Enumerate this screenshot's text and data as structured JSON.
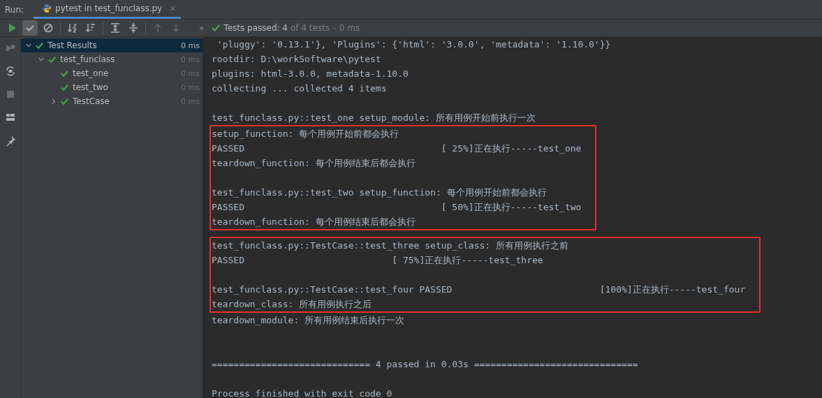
{
  "run_bar": {
    "label": "Run:",
    "tabs": [
      {
        "title": "pytest in test_funclass.py",
        "selected": true
      }
    ]
  },
  "toolbar": {
    "buttons": [
      {
        "kind": "run",
        "selected": false,
        "disabled": false
      },
      {
        "kind": "passed",
        "selected": true,
        "disabled": false
      },
      {
        "kind": "ignored",
        "selected": false,
        "disabled": false
      },
      {
        "kind": "sort-alpha",
        "selected": false,
        "disabled": false
      },
      {
        "kind": "sort-duration",
        "selected": false,
        "disabled": false
      },
      {
        "kind": "expand",
        "selected": false,
        "disabled": false
      },
      {
        "kind": "collapse",
        "selected": false,
        "disabled": false
      },
      {
        "kind": "up",
        "selected": false,
        "disabled": true
      },
      {
        "kind": "down",
        "selected": false,
        "disabled": true
      }
    ],
    "more": "»",
    "status": {
      "passed": true,
      "main": "Tests passed: 4",
      "detail": "of 4 tests – 0 ms"
    }
  },
  "side_buttons": [
    {
      "kind": "rerun",
      "disabled": true
    },
    {
      "kind": "toggle",
      "disabled": false
    },
    {
      "kind": "stop",
      "disabled": true
    },
    {
      "kind": "layout",
      "disabled": false
    },
    {
      "kind": "pin",
      "disabled": false
    }
  ],
  "tree": [
    {
      "label": "Test Results",
      "duration": "0 ms",
      "passed": true,
      "selected": true,
      "expanded": true,
      "children": [
        {
          "label": "test_funclass",
          "duration": "0 ms",
          "passed": true,
          "selected": false,
          "expanded": true,
          "children": [
            {
              "label": "test_one",
              "duration": "0 ms",
              "passed": true,
              "selected": false
            },
            {
              "label": "test_two",
              "duration": "0 ms",
              "passed": true,
              "selected": false
            },
            {
              "label": "TestCase",
              "duration": "0 ms",
              "passed": true,
              "selected": false,
              "expanded": false
            }
          ]
        }
      ]
    }
  ],
  "console": {
    "blocks": [
      {
        "highlighted": false,
        "paragraphs": [
          [
            " 'pluggy': '0.13.1'}, 'Plugins': {'html': '3.0.0', 'metadata': '1.10.0'}}",
            "rootdir: D:\\workSoftware\\pytest",
            "plugins: html-3.0.0, metadata-1.10.0",
            "collecting ... collected 4 items"
          ],
          [
            "test_funclass.py::test_one setup_module: 所有用例开始前执行一次"
          ]
        ]
      },
      {
        "highlighted": true,
        "paragraphs": [
          [
            "setup_function: 每个用例开始前都会执行",
            "PASSED                                    [ 25%]正在执行-----test_one",
            "teardown_function: 每个用例结束后都会执行"
          ],
          [
            "test_funclass.py::test_two setup_function: 每个用例开始前都会执行",
            "PASSED                                    [ 50%]正在执行-----test_two",
            "teardown_function: 每个用例结束后都会执行"
          ]
        ]
      },
      {
        "highlighted": true,
        "paragraphs": [
          [
            "test_funclass.py::TestCase::test_three setup_class: 所有用例执行之前",
            "PASSED                           [ 75%]正在执行-----test_three"
          ],
          [
            "test_funclass.py::TestCase::test_four PASSED                           [100%]正在执行-----test_four",
            "teardown_class: 所有用例执行之后"
          ]
        ]
      },
      {
        "highlighted": false,
        "paragraphs": [
          [
            "teardown_module: 所有用例结束后执行一次"
          ]
        ]
      }
    ],
    "summary": "============================= 4 passed in 0.03s ==============================",
    "exit_message": "Process finished with exit code 0"
  }
}
